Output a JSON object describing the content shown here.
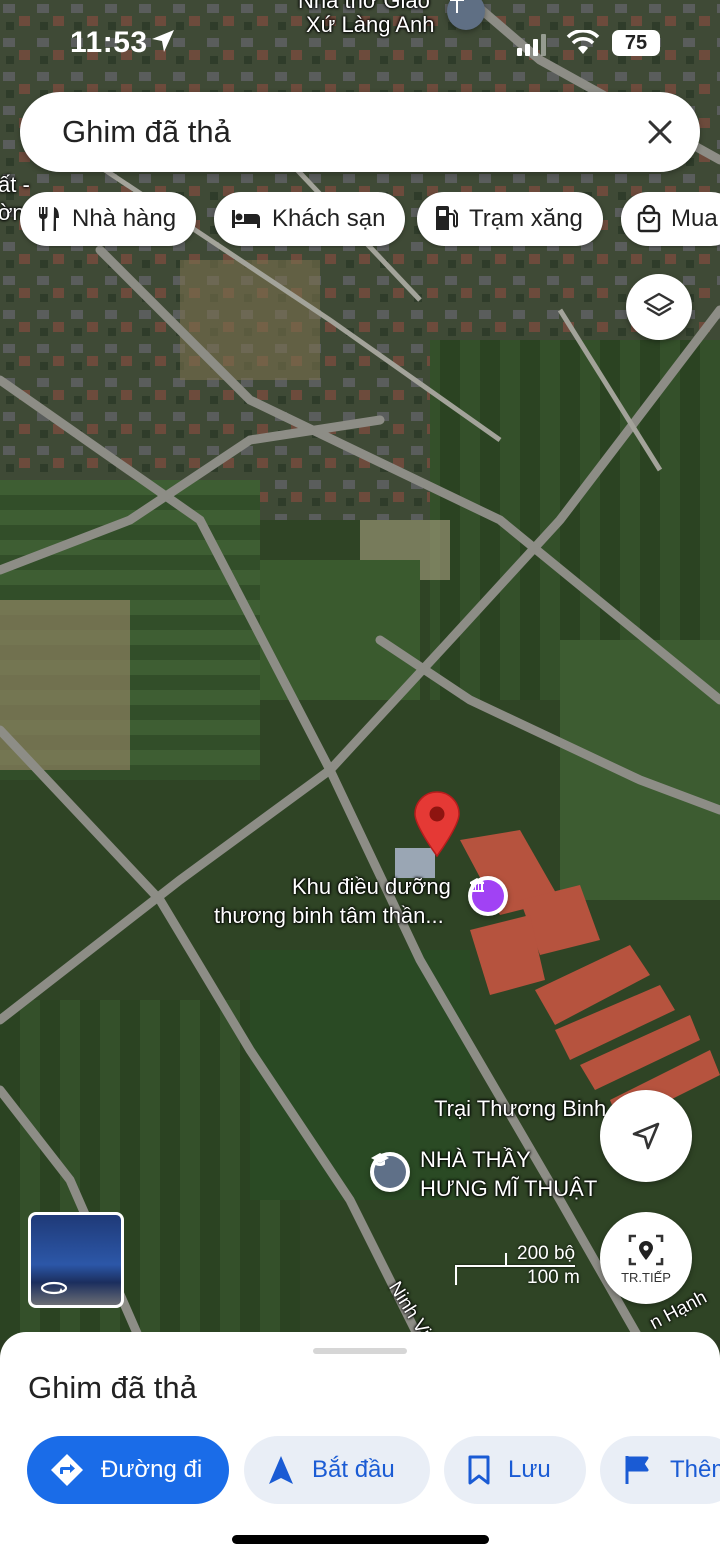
{
  "status_bar": {
    "time": "11:53",
    "battery": "75"
  },
  "search": {
    "query": "Ghim đã thả"
  },
  "chips": [
    {
      "label": "Nhà hàng",
      "icon": "fork-knife-icon"
    },
    {
      "label": "Khách sạn",
      "icon": "bed-icon"
    },
    {
      "label": "Trạm xăng",
      "icon": "fuel-pump-icon"
    },
    {
      "label": "Mua",
      "icon": "shopping-bag-icon"
    }
  ],
  "map": {
    "labels": {
      "top_place_line1": "Nhà thờ Giáo",
      "top_place_line2": "Xứ Làng Anh",
      "left_edge_line1": "ất -",
      "left_edge_line2": "ờn",
      "poi_line1": "Khu điều dưỡng",
      "poi_line2": "thương binh tâm thần...",
      "camp": "Trại Thương Binh",
      "school_line1": "NHÀ THẦY",
      "school_line2": "HƯNG MĨ THUẬT",
      "street1": "Ninh Viết Gi",
      "street2": "n Hạnh"
    },
    "scale": {
      "imperial": "200 bộ",
      "metric": "100 m"
    },
    "street_view_label": "TR.TIẾP"
  },
  "sheet": {
    "title": "Ghim đã thả",
    "actions": [
      "Đường đi",
      "Bắt đầu",
      "Lưu",
      "Thêm"
    ]
  },
  "colors": {
    "accent": "#1a6ce8",
    "pin": "#e53935",
    "poi": "#a142f4",
    "chip_bg": "#e9eef6"
  }
}
